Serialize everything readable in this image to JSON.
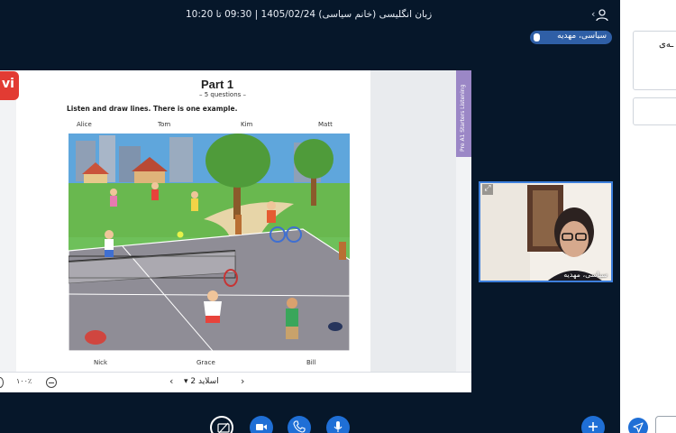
{
  "header": {
    "title": "زبان انگلیسی (خانم سیاسی) 1405/02/24 | 09:30 تا 10:20",
    "menu_glyph": "⋮",
    "back_glyph": "‹"
  },
  "presenter": {
    "name": "سیاسی، مهدیه"
  },
  "slide": {
    "logo_text": "vi",
    "part_title": "Part 1",
    "part_subtitle": "– 5 questions –",
    "instruction": "Listen and draw lines. There is one example.",
    "side_tab": "Pre A1 Starters Listening",
    "top_names": [
      "Alice",
      "Tom",
      "Kim",
      "Matt"
    ],
    "bottom_names": [
      "Nick",
      "Grace",
      "Bill"
    ]
  },
  "slide_controls": {
    "zoom": "۱۰۰٪",
    "slide_label": "اسلاید 2",
    "prev_glyph": "‹",
    "next_glyph": "›",
    "dropdown_glyph": "▾"
  },
  "video": {
    "name": "سیاسی، مهدیه"
  },
  "chat": {
    "header_text": "ـه‌ی"
  },
  "colors": {
    "background": "#06172a",
    "accent": "#1f6fd6",
    "badge": "#2f5fa6",
    "side_tab": "#9b87c6",
    "logo": "#e23b33"
  },
  "icons": [
    "user-icon",
    "menu-icon",
    "mic-icon",
    "share-screen-off-icon",
    "video-icon",
    "phone-icon",
    "plus-icon",
    "send-icon",
    "expand-icon"
  ]
}
